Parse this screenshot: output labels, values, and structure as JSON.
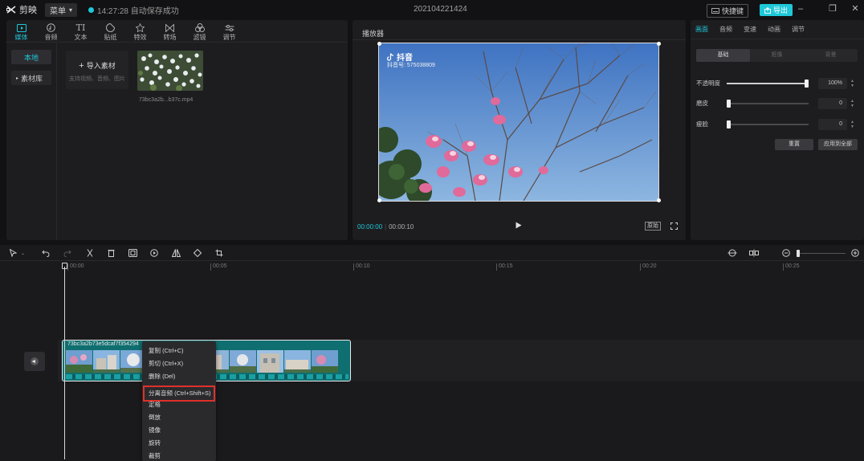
{
  "titlebar": {
    "app_name": "剪映",
    "menu_label": "菜单",
    "save_status": "14:27:28 自动保存成功",
    "doc_title": "20210422142​4",
    "shortcut_label": "快捷键",
    "export_label": "导出"
  },
  "media": {
    "tabs": [
      {
        "label": "媒体",
        "icon": "media-icon"
      },
      {
        "label": "音频",
        "icon": "audio-icon"
      },
      {
        "label": "文本",
        "icon": "text-icon"
      },
      {
        "label": "贴纸",
        "icon": "sticker-icon"
      },
      {
        "label": "特效",
        "icon": "effects-icon"
      },
      {
        "label": "转场",
        "icon": "transition-icon"
      },
      {
        "label": "滤镜",
        "icon": "filter-icon"
      },
      {
        "label": "调节",
        "icon": "adjust-icon"
      }
    ],
    "side_local": "本地",
    "side_library": "素材库",
    "import_label": "导入素材",
    "import_sub": "支持视频、音频、图片",
    "file_name": "73bc3a2b...b37c.mp4"
  },
  "player": {
    "title": "播放器",
    "watermark_brand": "抖音",
    "watermark_id": "抖音号: 575038809",
    "time_current": "00:00:00",
    "time_total": "00:00:10",
    "ratio_label": "原始"
  },
  "props": {
    "tabs": [
      "画面",
      "音频",
      "变速",
      "动画",
      "调节"
    ],
    "sub_tabs": [
      "基础",
      "抠像",
      "背景"
    ],
    "rows": [
      {
        "label": "不透明度",
        "value": "100%",
        "level": 1.0
      },
      {
        "label": "磨皮",
        "value": "0",
        "level": 0.0
      },
      {
        "label": "瘦脸",
        "value": "0",
        "level": 0.0
      }
    ],
    "reset_label": "重置",
    "apply_label": "应用到全部"
  },
  "timeline": {
    "ticks": [
      "00:00",
      "00:05",
      "00:10",
      "00:15",
      "00:20",
      "00:25"
    ],
    "clip_name": "73bc3a2b73e5dcaf7f354294",
    "zoom_level": 0.0
  },
  "context_menu": {
    "items": [
      {
        "label": "复制 (Ctrl+C)"
      },
      {
        "label": "剪切 (Ctrl+X)"
      },
      {
        "label": "删除 (Del)"
      },
      {
        "label": "分离音频 (Ctrl+Shift+S)",
        "highlight": true
      },
      {
        "label": "定格"
      },
      {
        "label": "倒放"
      },
      {
        "label": "镜像"
      },
      {
        "label": "旋转"
      },
      {
        "label": "裁剪"
      }
    ]
  },
  "colors": {
    "accent": "#1fc8d8",
    "highlight_border": "#e0302a",
    "clip": "#0f6f70"
  }
}
